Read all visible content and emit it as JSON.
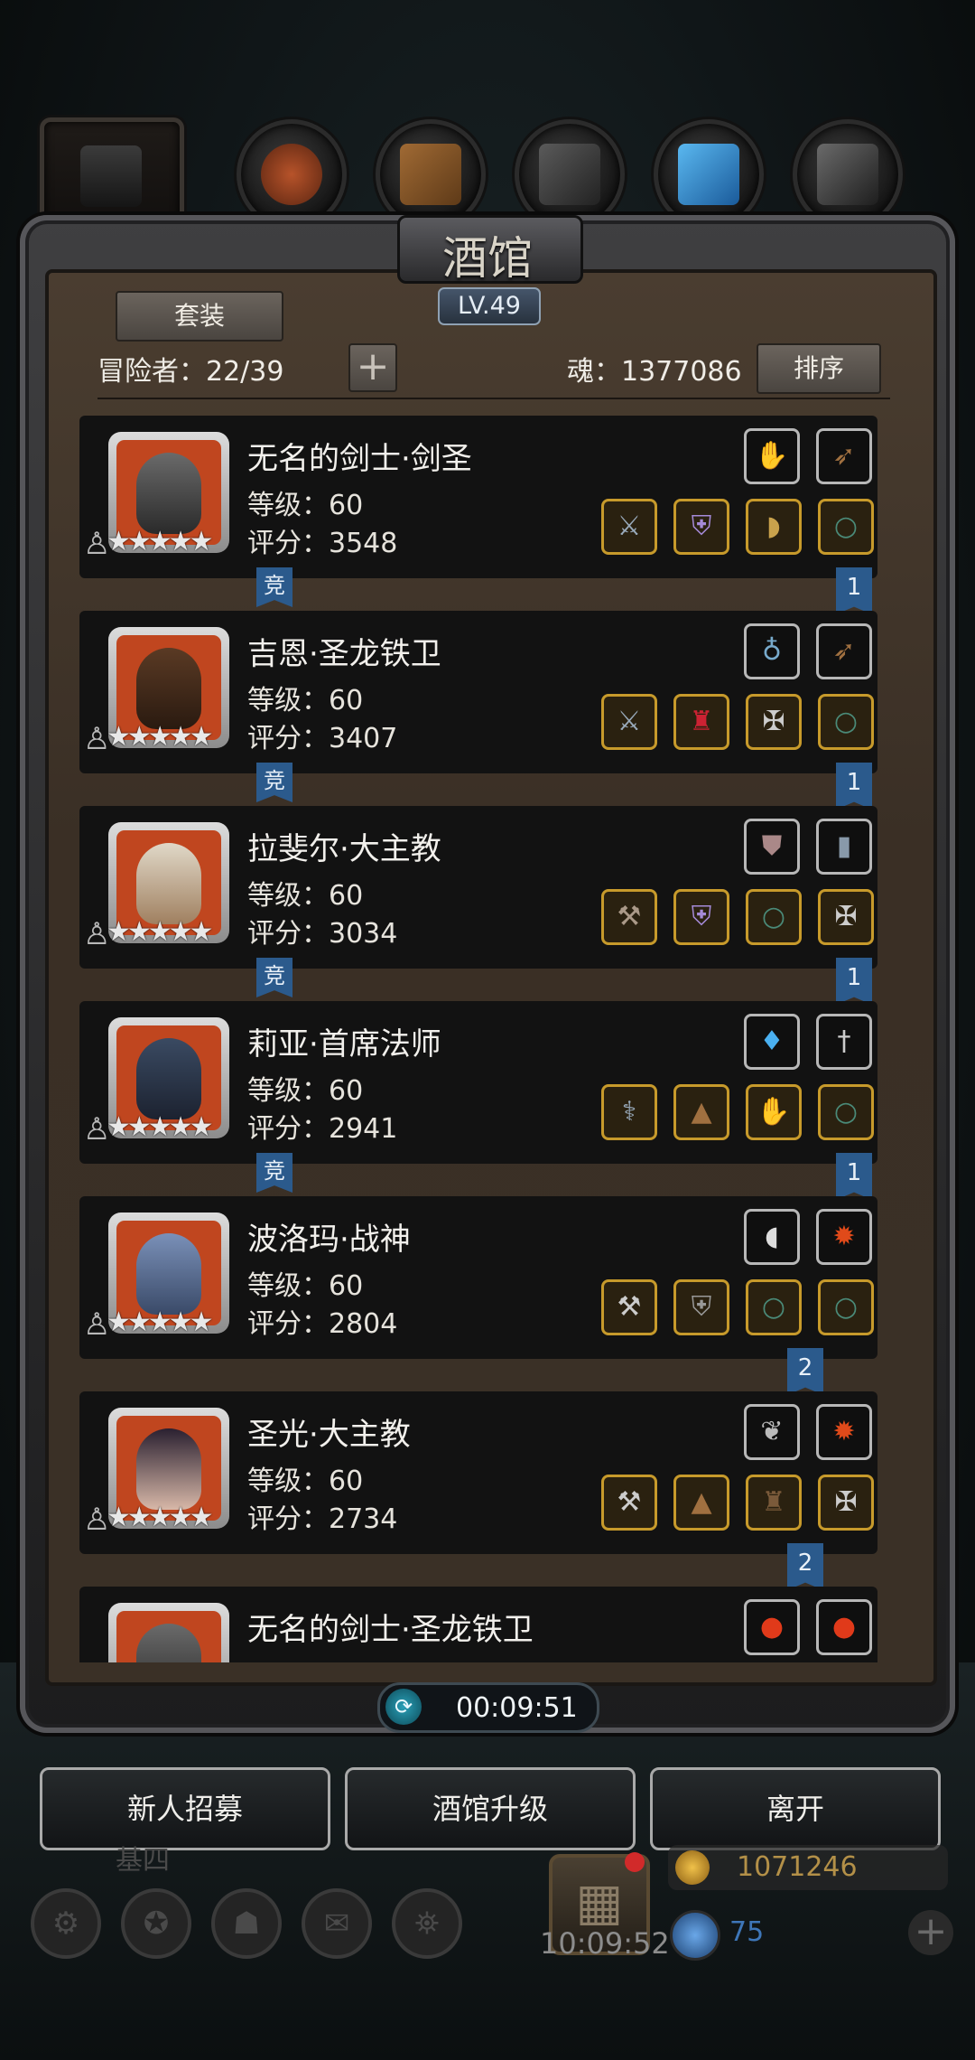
{
  "tavern": {
    "title": "酒馆",
    "level": "LV.49",
    "set_button": "套装",
    "adventurers_label": "冒险者：22/39",
    "add_symbol": "+",
    "soul_label": "魂：1377086",
    "sort_button": "排序"
  },
  "heroes": [
    {
      "name": "无名的剑士·剑圣",
      "level": "等级：60",
      "score": "评分：3548",
      "stars": "★★★★★",
      "competition_tag": "竞",
      "rank_tag": "1"
    },
    {
      "name": "吉恩·圣龙铁卫",
      "level": "等级：60",
      "score": "评分：3407",
      "stars": "★★★★★",
      "competition_tag": "竞",
      "rank_tag": "1"
    },
    {
      "name": "拉斐尔·大主教",
      "level": "等级：60",
      "score": "评分：3034",
      "stars": "★★★★★",
      "competition_tag": "竞",
      "rank_tag": "1"
    },
    {
      "name": "莉亚·首席法师",
      "level": "等级：60",
      "score": "评分：2941",
      "stars": "★★★★★",
      "competition_tag": "竞",
      "rank_tag": "1"
    },
    {
      "name": "波洛玛·战神",
      "level": "等级：60",
      "score": "评分：2804",
      "stars": "★★★★★",
      "rank_tag": "2"
    },
    {
      "name": "圣光·大主教",
      "level": "等级：60",
      "score": "评分：2734",
      "stars": "★★★★★",
      "rank_tag": "2"
    },
    {
      "name": "无名的剑士·圣龙铁卫"
    }
  ],
  "timer": {
    "value": "00:09:51"
  },
  "buttons": {
    "recruit": "新人招募",
    "upgrade": "酒馆升级",
    "leave": "离开"
  },
  "hud": {
    "gold": "1071246",
    "gems": "75",
    "clock": "10:09:52",
    "map_label": "基四"
  },
  "icons": {
    "star": "★",
    "figure": "♙",
    "timer": "⟳",
    "gift": "▦",
    "plus": "+"
  },
  "colors": {
    "tag_blue": "#2b5a8c",
    "portrait_orange": "#c0461f",
    "gold_border": "#c79a2b",
    "gold_text": "#b39048",
    "gem_text": "#3e76b8"
  }
}
